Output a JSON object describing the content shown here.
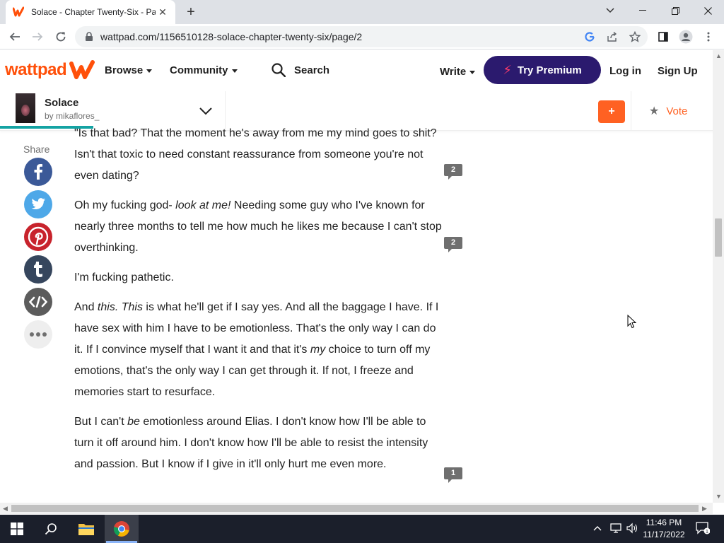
{
  "browser": {
    "tab_title": "Solace - Chapter Twenty-Six - Pa",
    "tab_close": "✕",
    "new_tab": "+",
    "url": "wattpad.com/1156510128-solace-chapter-twenty-six/page/2",
    "icons": [
      "back-icon",
      "forward-icon",
      "reload-icon",
      "lock-icon",
      "google-icon",
      "share-icon",
      "star-icon",
      "sidebar-icon",
      "profile-icon",
      "menu-icon"
    ]
  },
  "header": {
    "logo": "wattpad",
    "browse": "Browse",
    "community": "Community",
    "search": "Search",
    "write": "Write",
    "premium": "Try Premium",
    "login": "Log in",
    "signup": "Sign Up",
    "accent": "#ff500a",
    "premium_color": "#2b1a6e"
  },
  "story": {
    "title": "Solace",
    "author": "by mikaflores_",
    "add": "+",
    "vote": "Vote"
  },
  "share": {
    "label": "Share",
    "buttons": [
      {
        "name": "facebook",
        "glyph": "f",
        "color": "#3b5998"
      },
      {
        "name": "twitter",
        "glyph": "t",
        "color": "#4ea8e8"
      },
      {
        "name": "pinterest",
        "glyph": "P",
        "color": "#c8232c"
      },
      {
        "name": "tumblr",
        "glyph": "t",
        "color": "#36465d"
      },
      {
        "name": "embed",
        "glyph": "</>",
        "color": "#5c5c5c"
      },
      {
        "name": "more",
        "glyph": "•••",
        "color": "#eeeeee"
      }
    ]
  },
  "paragraphs": {
    "p1": "\"Is that bad? That the moment he's away from me my mind goes to shit? Isn't that toxic to need constant reassurance from someone you're not even dating?",
    "p1_comments": "2",
    "p2_a": "Oh my fucking god- ",
    "p2_b": "look at me!",
    "p2_c": " Needing some guy who I've known for nearly three months to tell me how much he likes me because I can't stop overthinking.",
    "p2_comments": "2",
    "p3": "I'm fucking pathetic.",
    "p4_a": "And ",
    "p4_b": "this. This",
    "p4_c": " is what he'll get if I say yes. And all the baggage I have. If I have sex with him I have to be emotionless. That's the only way I can do it. If I convince myself that I want it and that it's ",
    "p4_d": "my",
    "p4_e": " choice to turn off my emotions, that's the only way I can get through it. If not, I freeze and memories start to resurface.",
    "p5_a": "But I can't ",
    "p5_b": "be",
    "p5_c": " emotionless around Elias. I don't know how I'll be able to turn it off around him. I don't know how I'll be able to resist the intensity and passion. But I know if I give in it'll only hurt me even more.",
    "p5_comments": "1"
  },
  "taskbar": {
    "time": "11:46 PM",
    "date": "11/17/2022",
    "notifications": "1"
  }
}
